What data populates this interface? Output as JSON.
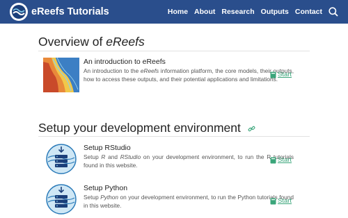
{
  "nav": {
    "brand": "eReefs Tutorials",
    "links": [
      "Home",
      "About",
      "Research",
      "Outputs",
      "Contact"
    ]
  },
  "sections": [
    {
      "title_plain": "Overview of ",
      "title_em": "eReefs"
    },
    {
      "title": "Setup your development environment"
    }
  ],
  "items": [
    {
      "title": "An introduction to eReefs",
      "desc_1": "An introduction to the ",
      "desc_em": "eReefs",
      "desc_2": " information platform, the core models, their outputs, how to access these outputs, and their potential applications and limitations.",
      "action": "Start"
    },
    {
      "title": "Setup RStudio",
      "desc_1": "Setup ",
      "desc_em": "R",
      "desc_2": " and ",
      "desc_em2": "RStudio",
      "desc_3": " on your development environment, to run the R tutorials found in this website.",
      "action": "Start"
    },
    {
      "title": "Setup Python",
      "desc_1": "Setup ",
      "desc_em": "Python",
      "desc_2": " on your development environment, to run the Python tutorials found in this website.",
      "action": "Start"
    }
  ],
  "colors": {
    "navbar": "#2a4e8c",
    "start": "#3aa57a",
    "link_icon": "#3aa57a"
  },
  "icons": [
    "logo",
    "search-icon",
    "link-icon",
    "book-icon",
    "server-icon",
    "map-thumbnail"
  ]
}
